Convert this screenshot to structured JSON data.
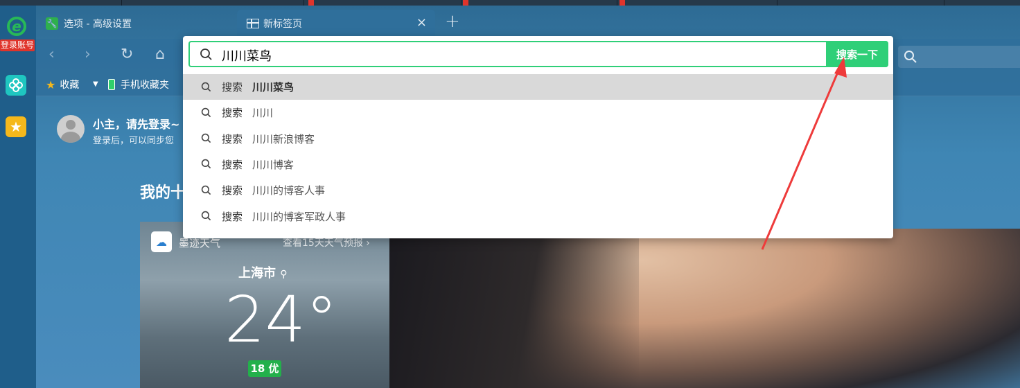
{
  "tabs": {
    "options_label": "选项 - 高级设置",
    "new_tab_label": "新标签页",
    "close_glyph": "×",
    "plus_glyph": "+"
  },
  "sidebar": {
    "login_badge": "登录账号",
    "logo_glyph": "e",
    "star_glyph": "★"
  },
  "nav": {
    "back_glyph": "‹",
    "forward_glyph": "›",
    "refresh_glyph": "↻",
    "home_glyph": "⌂"
  },
  "bookmarks": {
    "favorites_label": "收藏",
    "caret_glyph": "▼",
    "mobile_label": "手机收藏夹"
  },
  "user": {
    "title": "小主，请先登录~",
    "subtitle": "登录后，可以同步您"
  },
  "section_title": "我的十",
  "weather": {
    "brand": "墨迹天气",
    "forecast_link": "查看15天天气预报 ›",
    "city": "上海市",
    "temperature": "24°",
    "aqi": "18 优"
  },
  "search": {
    "query": "川川菜鸟",
    "button_label": "搜索一下",
    "suggestions": [
      {
        "verb": "搜索",
        "term": "川川菜鸟"
      },
      {
        "verb": "搜索",
        "term": "川川"
      },
      {
        "verb": "搜索",
        "term": "川川新浪博客"
      },
      {
        "verb": "搜索",
        "term": "川川博客"
      },
      {
        "verb": "搜索",
        "term": "川川的博客人事"
      },
      {
        "verb": "搜索",
        "term": "川川的博客军政人事"
      }
    ]
  },
  "colors": {
    "accent_green": "#2fcf78",
    "annotation_red": "#ee3b3b",
    "badge_red": "#e0342b"
  }
}
